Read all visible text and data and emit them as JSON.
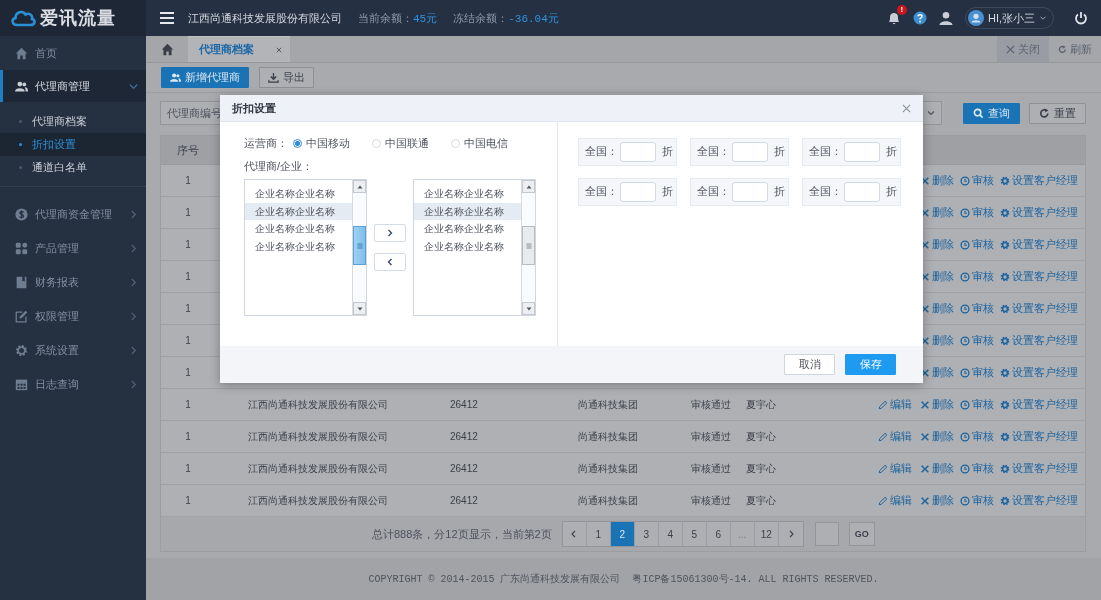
{
  "app": {
    "logo": "爱讯流量"
  },
  "sidebar": {
    "items": [
      {
        "kind": "link",
        "label": "首页",
        "selected": false
      },
      {
        "kind": "group",
        "label": "代理商管理",
        "selected": true,
        "expanded": true,
        "children": [
          {
            "label": "代理商档案",
            "selected": false
          },
          {
            "label": "折扣设置",
            "selected": true
          },
          {
            "label": "通道白名单",
            "selected": false
          }
        ]
      },
      {
        "kind": "group",
        "label": "代理商资金管理",
        "selected": false,
        "expanded": false
      },
      {
        "kind": "group",
        "label": "产品管理",
        "selected": false,
        "expanded": false
      },
      {
        "kind": "group",
        "label": "财务报表",
        "selected": false,
        "expanded": false
      },
      {
        "kind": "group",
        "label": "权限管理",
        "selected": false,
        "expanded": false
      },
      {
        "kind": "group",
        "label": "系统设置",
        "selected": false,
        "expanded": false
      },
      {
        "kind": "group",
        "label": "日志查询",
        "selected": false,
        "expanded": false
      }
    ]
  },
  "topbar": {
    "company": "江西尚通科技发展股份有限公司",
    "balances": [
      {
        "label": "当前余额：",
        "value": "45元"
      },
      {
        "label": "冻结余额：",
        "value": "-36.04元"
      }
    ],
    "notification_badge": "!",
    "user": "HI,张小三"
  },
  "tabs": {
    "items": [
      {
        "label": "代理商档案",
        "selected": true
      }
    ],
    "actions": [
      {
        "kind": "close",
        "label": "关闭"
      },
      {
        "kind": "refresh",
        "label": "刷新"
      }
    ]
  },
  "toolbar": [
    {
      "kind": "add",
      "label": "新增代理商"
    },
    {
      "kind": "export",
      "label": "导出"
    }
  ],
  "search": {
    "placeholder": "代理商编号",
    "buttons": [
      {
        "kind": "query",
        "label": "查询"
      },
      {
        "kind": "reset",
        "label": "重置"
      }
    ]
  },
  "table": {
    "columns": [
      "序号"
    ],
    "rows": [
      {
        "cells": [
          "1"
        ],
        "actions": [
          {
            "kind": "delete",
            "label": "删除"
          },
          {
            "kind": "audit",
            "label": "审核"
          },
          {
            "kind": "manager",
            "label": "设置客户经理"
          }
        ]
      },
      {
        "cells": [
          "1"
        ],
        "actions": [
          {
            "kind": "delete",
            "label": "删除"
          },
          {
            "kind": "audit",
            "label": "审核"
          },
          {
            "kind": "manager",
            "label": "设置客户经理"
          }
        ]
      },
      {
        "cells": [
          "1"
        ],
        "actions": [
          {
            "kind": "delete",
            "label": "删除"
          },
          {
            "kind": "audit",
            "label": "审核"
          },
          {
            "kind": "manager",
            "label": "设置客户经理"
          }
        ]
      },
      {
        "cells": [
          "1"
        ],
        "actions": [
          {
            "kind": "delete",
            "label": "删除"
          },
          {
            "kind": "audit",
            "label": "审核"
          },
          {
            "kind": "manager",
            "label": "设置客户经理"
          }
        ]
      },
      {
        "cells": [
          "1"
        ],
        "actions": [
          {
            "kind": "delete",
            "label": "删除"
          },
          {
            "kind": "audit",
            "label": "审核"
          },
          {
            "kind": "manager",
            "label": "设置客户经理"
          }
        ]
      },
      {
        "cells": [
          "1"
        ],
        "actions": [
          {
            "kind": "delete",
            "label": "删除"
          },
          {
            "kind": "audit",
            "label": "审核"
          },
          {
            "kind": "manager",
            "label": "设置客户经理"
          }
        ]
      },
      {
        "cells": [
          "1"
        ],
        "actions": [
          {
            "kind": "delete",
            "label": "删除"
          },
          {
            "kind": "audit",
            "label": "审核"
          },
          {
            "kind": "manager",
            "label": "设置客户经理"
          }
        ]
      },
      {
        "cells": [
          "1",
          "江西尚通科技发展股份有限公司",
          "26412",
          "尚通科技集团",
          "审核通过",
          "夏宇心"
        ],
        "actions": [
          {
            "kind": "edit",
            "label": "编辑"
          },
          {
            "kind": "delete",
            "label": "删除"
          },
          {
            "kind": "audit",
            "label": "审核"
          },
          {
            "kind": "manager",
            "label": "设置客户经理"
          }
        ]
      },
      {
        "cells": [
          "1",
          "江西尚通科技发展股份有限公司",
          "26412",
          "尚通科技集团",
          "审核通过",
          "夏宇心"
        ],
        "actions": [
          {
            "kind": "edit",
            "label": "编辑"
          },
          {
            "kind": "delete",
            "label": "删除"
          },
          {
            "kind": "audit",
            "label": "审核"
          },
          {
            "kind": "manager",
            "label": "设置客户经理"
          }
        ]
      },
      {
        "cells": [
          "1",
          "江西尚通科技发展股份有限公司",
          "26412",
          "尚通科技集团",
          "审核通过",
          "夏宇心"
        ],
        "actions": [
          {
            "kind": "edit",
            "label": "编辑"
          },
          {
            "kind": "delete",
            "label": "删除"
          },
          {
            "kind": "audit",
            "label": "审核"
          },
          {
            "kind": "manager",
            "label": "设置客户经理"
          }
        ]
      },
      {
        "cells": [
          "1",
          "江西尚通科技发展股份有限公司",
          "26412",
          "尚通科技集团",
          "审核通过",
          "夏宇心"
        ],
        "actions": [
          {
            "kind": "edit",
            "label": "编辑"
          },
          {
            "kind": "delete",
            "label": "删除"
          },
          {
            "kind": "audit",
            "label": "审核"
          },
          {
            "kind": "manager",
            "label": "设置客户经理"
          }
        ]
      }
    ]
  },
  "pagination": {
    "summary": "总计888条，分12页显示，当前第2页",
    "pages": [
      {
        "label": "1",
        "selected": false,
        "disabled": false
      },
      {
        "label": "2",
        "selected": true,
        "disabled": false
      },
      {
        "label": "3",
        "selected": false,
        "disabled": false
      },
      {
        "label": "4",
        "selected": false,
        "disabled": false
      },
      {
        "label": "5",
        "selected": false,
        "disabled": false
      },
      {
        "label": "6",
        "selected": false,
        "disabled": false
      },
      {
        "label": "...",
        "selected": false,
        "disabled": true
      },
      {
        "label": "12",
        "selected": false,
        "disabled": false
      }
    ],
    "go": "GO"
  },
  "footer": "COPYRIGHT © 2014-2015 广东尚通科技发展有限公司  粤ICP备15061300号-14. ALL RIGHTS RESERVED.",
  "dialog": {
    "title": "折扣设置",
    "operator_label": "运营商：",
    "operators": [
      {
        "label": "中国移动",
        "selected": true
      },
      {
        "label": "中国联通",
        "selected": false
      },
      {
        "label": "中国电信",
        "selected": false
      }
    ],
    "list_label": "代理商/企业：",
    "left_list": [
      {
        "label": "企业名称企业名称",
        "selected": false
      },
      {
        "label": "企业名称企业名称",
        "selected": true
      },
      {
        "label": "企业名称企业名称",
        "selected": false
      },
      {
        "label": "企业名称企业名称",
        "selected": false
      }
    ],
    "right_list": [
      {
        "label": "企业名称企业名称",
        "selected": false
      },
      {
        "label": "企业名称企业名称",
        "selected": true
      },
      {
        "label": "企业名称企业名称",
        "selected": false
      },
      {
        "label": "企业名称企业名称",
        "selected": false
      }
    ],
    "discounts": [
      {
        "label": "全国：",
        "suffix": "折"
      },
      {
        "label": "全国：",
        "suffix": "折"
      },
      {
        "label": "全国：",
        "suffix": "折"
      },
      {
        "label": "全国：",
        "suffix": "折"
      },
      {
        "label": "全国：",
        "suffix": "折"
      },
      {
        "label": "全国：",
        "suffix": "折"
      }
    ],
    "buttons": [
      {
        "kind": "cancel",
        "label": "取消"
      },
      {
        "kind": "save",
        "label": "保存"
      }
    ]
  }
}
